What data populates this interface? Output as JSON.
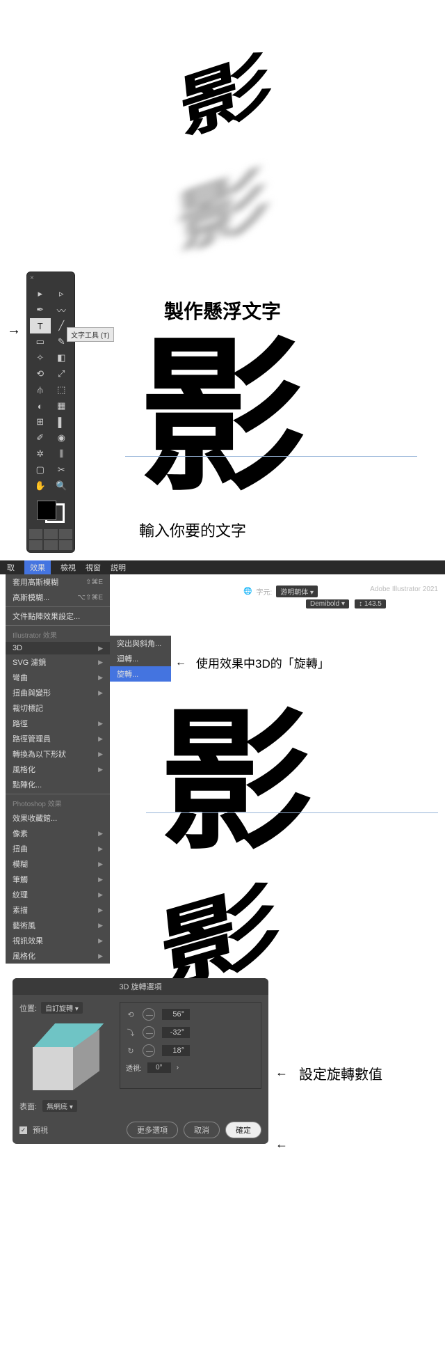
{
  "section1": {
    "demo_char": "影",
    "title": "製作懸浮文字"
  },
  "section2": {
    "tooltip": "文字工具 (T)",
    "big_char": "影",
    "caption": "輸入你要的文字",
    "tool_glyphs": [
      "▶",
      "◩",
      "✒",
      "〰",
      "T",
      "╱",
      "◯",
      "◢",
      "✑",
      "◆",
      "▦",
      "⬚",
      "✎",
      "◐",
      "◫",
      "⊞",
      "✂",
      "▭",
      "◉",
      "✚",
      "✋",
      "🔍"
    ]
  },
  "section3": {
    "menu_names": {
      "take": "取",
      "effect": "效果",
      "view": "檢視",
      "window": "視窗",
      "help": "説明"
    },
    "app_title": "Adobe Illustrator 2021",
    "char_label": "字元:",
    "font_name": "游明朝体",
    "font_weight": "Demibold",
    "font_size": "143.5",
    "menu": {
      "apply_blur": "套用高斯模糊",
      "apply_sc": "⇧⌘E",
      "blur": "高斯模糊...",
      "blur_sc": "⌥⇧⌘E",
      "raster_settings": "文件點陣效果設定...",
      "ai_header": "Illustrator 效果",
      "threeD": "3D",
      "svg": "SVG 濾鏡",
      "warp": "彎曲",
      "distort": "扭曲與變形",
      "crop": "裁切標記",
      "path": "路徑",
      "pathfinder": "路徑管理員",
      "convert": "轉換為以下形狀",
      "stylize_ai": "風格化",
      "rasterize": "點陣化...",
      "ps_header": "Photoshop 效果",
      "gallery": "效果收藏館...",
      "pixelate": "像素",
      "distort_ps": "扭曲",
      "blur_ps": "模糊",
      "brush": "筆觸",
      "texture": "紋理",
      "sketch": "素描",
      "artistic": "藝術風",
      "video": "視訊效果",
      "stylize_ps": "風格化"
    },
    "submenu": {
      "extrude": "突出與斜角...",
      "revolve": "迴轉...",
      "rotate": "旋轉..."
    },
    "note": "使用效果中3D的「旋轉」",
    "big_char": "影"
  },
  "section4": {
    "demo_char": "影",
    "dialog_title": "3D 旋轉選項",
    "position_label": "位置:",
    "position_value": "自訂旋轉",
    "rot": {
      "x_label": "⟲",
      "x": "56°",
      "y_label": "⟳",
      "y": "-32°",
      "z_label": "↻",
      "z": "18°"
    },
    "perspective_label": "透視:",
    "perspective_value": "0°",
    "surface_label": "表面:",
    "surface_value": "無網底",
    "preview": "預視",
    "more": "更多選項",
    "cancel": "取消",
    "ok": "確定",
    "note": "設定旋轉數值"
  }
}
